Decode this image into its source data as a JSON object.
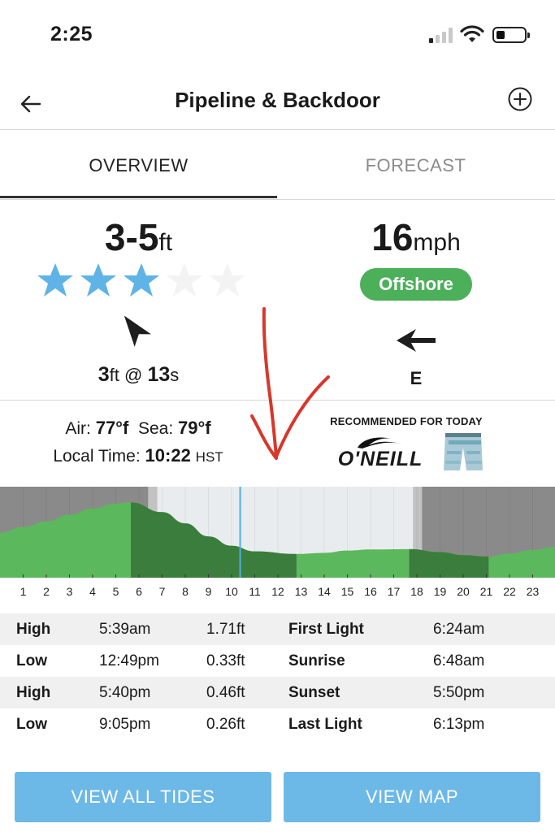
{
  "status_bar": {
    "time": "2:25"
  },
  "header": {
    "title": "Pipeline & Backdoor",
    "back_icon": "arrow-left-icon",
    "add_icon": "plus-circle-icon"
  },
  "tabs": [
    {
      "label": "OVERVIEW",
      "active": true
    },
    {
      "label": "FORECAST",
      "active": false
    }
  ],
  "surf": {
    "height": "3-5",
    "height_unit": "ft",
    "rating_stars": 3,
    "rating_max": 5,
    "swell_height": "3",
    "swell_height_unit": "ft",
    "swell_at": "@",
    "swell_period": "13",
    "swell_period_unit": "s"
  },
  "wind": {
    "speed": "16",
    "speed_unit": "mph",
    "condition": "Offshore",
    "direction": "E"
  },
  "weather": {
    "air_label": "Air:",
    "air_value": "77°f",
    "sea_label": "Sea:",
    "sea_value": "79°f",
    "local_time_label": "Local Time:",
    "local_time_value": "10:22",
    "timezone": "HST"
  },
  "ad": {
    "heading": "RECOMMENDED FOR TODAY",
    "brand": "O'NEILL"
  },
  "tide_chart": {
    "hours": [
      1,
      2,
      3,
      4,
      5,
      6,
      7,
      8,
      9,
      10,
      11,
      12,
      13,
      14,
      15,
      16,
      17,
      18,
      19,
      20,
      21,
      22,
      23
    ],
    "current_hour": 10.37,
    "first_light": 6.4,
    "sunrise": 6.8,
    "sunset": 17.83,
    "last_light": 18.22,
    "tide_points": [
      [
        0,
        0.9
      ],
      [
        1,
        1.05
      ],
      [
        2,
        1.2
      ],
      [
        3,
        1.38
      ],
      [
        4,
        1.55
      ],
      [
        5,
        1.68
      ],
      [
        5.65,
        1.71
      ],
      [
        7,
        1.45
      ],
      [
        8,
        1.15
      ],
      [
        9,
        0.8
      ],
      [
        10,
        0.55
      ],
      [
        11,
        0.4
      ],
      [
        12.8,
        0.33
      ],
      [
        14,
        0.36
      ],
      [
        15,
        0.42
      ],
      [
        16,
        0.45
      ],
      [
        17.67,
        0.46
      ],
      [
        19,
        0.38
      ],
      [
        20,
        0.3
      ],
      [
        21.1,
        0.26
      ],
      [
        22,
        0.34
      ],
      [
        23,
        0.44
      ],
      [
        24,
        0.52
      ]
    ],
    "colors": {
      "light": "#5cb85c",
      "dark": "#3a7d3c",
      "night": "#8a8a8a",
      "twilight": "#c2c2c2",
      "day": "#e9ecee",
      "now": "#4fb0e0"
    }
  },
  "tides": [
    {
      "type": "High",
      "time": "5:39am",
      "height": "1.71ft",
      "label": "First Light",
      "value": "6:24am"
    },
    {
      "type": "Low",
      "time": "12:49pm",
      "height": "0.33ft",
      "label": "Sunrise",
      "value": "6:48am"
    },
    {
      "type": "High",
      "time": "5:40pm",
      "height": "0.46ft",
      "label": "Sunset",
      "value": "5:50pm"
    },
    {
      "type": "Low",
      "time": "9:05pm",
      "height": "0.26ft",
      "label": "Last Light",
      "value": "6:13pm"
    }
  ],
  "buttons": {
    "view_all_tides": "VIEW ALL TIDES",
    "view_map": "VIEW MAP"
  }
}
